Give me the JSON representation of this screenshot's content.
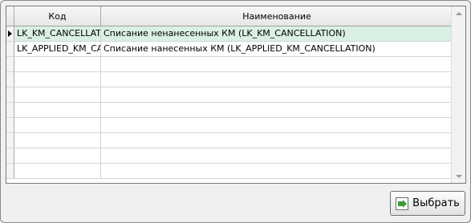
{
  "grid": {
    "columns": {
      "code": "Код",
      "name": "Наименование"
    },
    "rows": [
      {
        "code": "LK_KM_CANCELLATION",
        "name": "Списание ненанесенных КМ (LK_KM_CANCELLATION)",
        "selected": true
      },
      {
        "code": "LK_APPLIED_KM_CANCELLATION",
        "name": "Списание нанесенных КМ (LK_APPLIED_KM_CANCELLATION)",
        "selected": false
      },
      {
        "code": "",
        "name": "",
        "selected": false
      },
      {
        "code": "",
        "name": "",
        "selected": false
      },
      {
        "code": "",
        "name": "",
        "selected": false
      },
      {
        "code": "",
        "name": "",
        "selected": false
      },
      {
        "code": "",
        "name": "",
        "selected": false
      },
      {
        "code": "",
        "name": "",
        "selected": false
      },
      {
        "code": "",
        "name": "",
        "selected": false
      },
      {
        "code": "",
        "name": "",
        "selected": false
      }
    ]
  },
  "footer": {
    "select_label": "Выбрать"
  },
  "icons": {
    "current_row": "row-pointer-icon",
    "select": "select-icon",
    "scroll_up": "scroll-up-icon",
    "scroll_down": "scroll-down-icon"
  }
}
